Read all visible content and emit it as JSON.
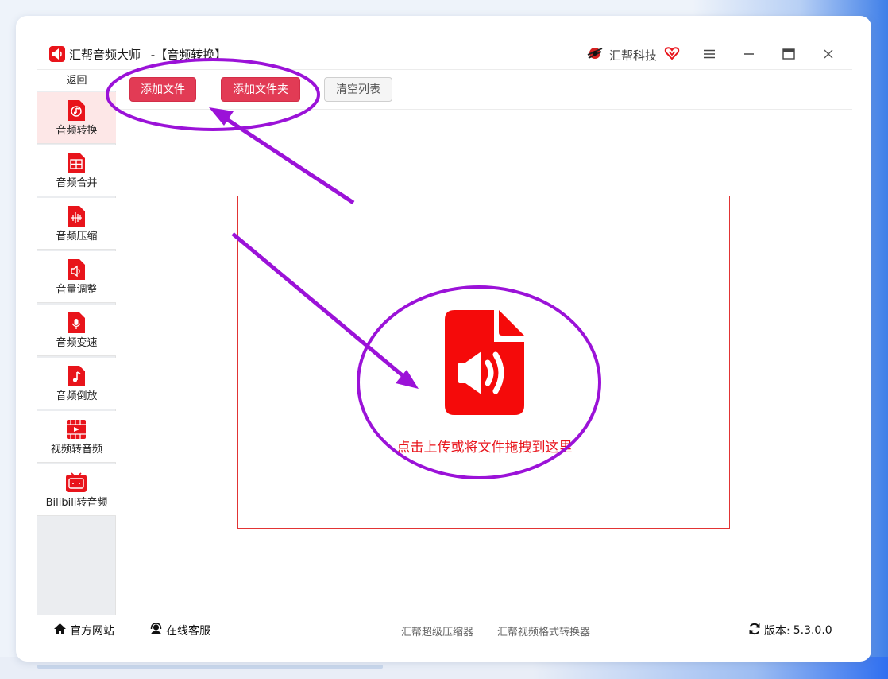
{
  "window": {
    "app_name": "汇帮音频大师",
    "module_title": "-【音频转换】",
    "brand": "汇帮科技"
  },
  "sidebar": {
    "back_label": "返回",
    "items": [
      {
        "label": "音频转换",
        "icon": "audio-convert-icon",
        "active": true
      },
      {
        "label": "音频合并",
        "icon": "audio-merge-icon",
        "active": false
      },
      {
        "label": "音频压缩",
        "icon": "audio-compress-icon",
        "active": false
      },
      {
        "label": "音量调整",
        "icon": "volume-icon",
        "active": false
      },
      {
        "label": "音频变速",
        "icon": "microphone-icon",
        "active": false
      },
      {
        "label": "音频倒放",
        "icon": "music-note-icon",
        "active": false
      },
      {
        "label": "视频转音频",
        "icon": "film-icon",
        "active": false
      },
      {
        "label": "Bilibili转音频",
        "icon": "tv-icon",
        "active": false
      }
    ]
  },
  "toolbar": {
    "add_file": "添加文件",
    "add_folder": "添加文件夹",
    "clear_list": "清空列表"
  },
  "dropzone": {
    "text": "点击上传或将文件拖拽到这里",
    "icon": "audio-file-icon"
  },
  "footer": {
    "website": "官方网站",
    "support": "在线客服",
    "link1": "汇帮超级压缩器",
    "link2": "汇帮视频格式转换器",
    "version_label": "版本:",
    "version": "5.3.0.0"
  },
  "colors": {
    "accent_red": "#e8141b",
    "button_red": "#e23b55",
    "annotation_purple": "#9b12d8"
  }
}
